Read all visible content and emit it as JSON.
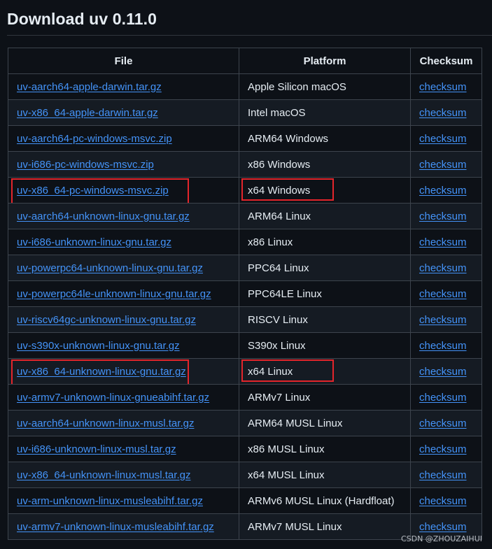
{
  "page": {
    "title": "Download uv 0.11.0"
  },
  "table": {
    "headers": {
      "file": "File",
      "platform": "Platform",
      "checksum": "Checksum"
    },
    "rows": [
      {
        "file": "uv-aarch64-apple-darwin.tar.gz",
        "platform": "Apple Silicon macOS",
        "checksum": "checksum",
        "highlighted": false
      },
      {
        "file": "uv-x86_64-apple-darwin.tar.gz",
        "platform": "Intel macOS",
        "checksum": "checksum",
        "highlighted": false
      },
      {
        "file": "uv-aarch64-pc-windows-msvc.zip",
        "platform": "ARM64 Windows",
        "checksum": "checksum",
        "highlighted": false
      },
      {
        "file": "uv-i686-pc-windows-msvc.zip",
        "platform": "x86 Windows",
        "checksum": "checksum",
        "highlighted": false
      },
      {
        "file": "uv-x86_64-pc-windows-msvc.zip",
        "platform": "x64 Windows",
        "checksum": "checksum",
        "highlighted": true
      },
      {
        "file": "uv-aarch64-unknown-linux-gnu.tar.gz",
        "platform": "ARM64 Linux",
        "checksum": "checksum",
        "highlighted": false
      },
      {
        "file": "uv-i686-unknown-linux-gnu.tar.gz",
        "platform": "x86 Linux",
        "checksum": "checksum",
        "highlighted": false
      },
      {
        "file": "uv-powerpc64-unknown-linux-gnu.tar.gz",
        "platform": "PPC64 Linux",
        "checksum": "checksum",
        "highlighted": false
      },
      {
        "file": "uv-powerpc64le-unknown-linux-gnu.tar.gz",
        "platform": "PPC64LE Linux",
        "checksum": "checksum",
        "highlighted": false
      },
      {
        "file": "uv-riscv64gc-unknown-linux-gnu.tar.gz",
        "platform": "RISCV Linux",
        "checksum": "checksum",
        "highlighted": false
      },
      {
        "file": "uv-s390x-unknown-linux-gnu.tar.gz",
        "platform": "S390x Linux",
        "checksum": "checksum",
        "highlighted": false
      },
      {
        "file": "uv-x86_64-unknown-linux-gnu.tar.gz",
        "platform": "x64 Linux",
        "checksum": "checksum",
        "highlighted": true
      },
      {
        "file": "uv-armv7-unknown-linux-gnueabihf.tar.gz",
        "platform": "ARMv7 Linux",
        "checksum": "checksum",
        "highlighted": false
      },
      {
        "file": "uv-aarch64-unknown-linux-musl.tar.gz",
        "platform": "ARM64 MUSL Linux",
        "checksum": "checksum",
        "highlighted": false
      },
      {
        "file": "uv-i686-unknown-linux-musl.tar.gz",
        "platform": "x86 MUSL Linux",
        "checksum": "checksum",
        "highlighted": false
      },
      {
        "file": "uv-x86_64-unknown-linux-musl.tar.gz",
        "platform": "x64 MUSL Linux",
        "checksum": "checksum",
        "highlighted": false
      },
      {
        "file": "uv-arm-unknown-linux-musleabihf.tar.gz",
        "platform": "ARMv6 MUSL Linux (Hardfloat)",
        "checksum": "checksum",
        "highlighted": false
      },
      {
        "file": "uv-armv7-unknown-linux-musleabihf.tar.gz",
        "platform": "ARMv7 MUSL Linux",
        "checksum": "checksum",
        "highlighted": false
      }
    ]
  },
  "watermark": "CSDN @ZHOUZAIHUI",
  "colors": {
    "background": "#0d1117",
    "link": "#4493f8",
    "border": "#3d444d",
    "highlight_box": "#e3252b"
  }
}
